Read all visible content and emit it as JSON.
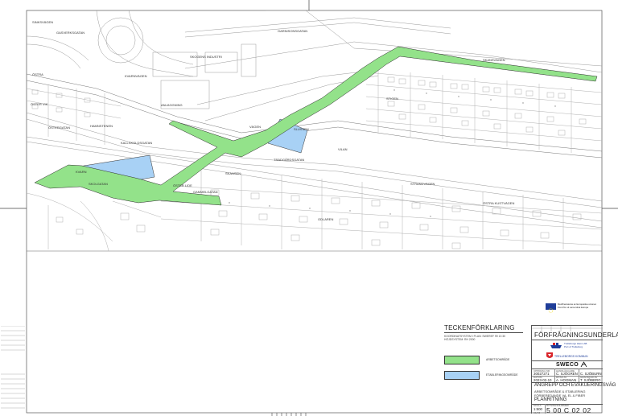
{
  "map": {
    "place_labels": {
      "sinksvagen": "SINKSVÄGEN",
      "gasverksgatan": "GASVERKSGATAN",
      "garnisonsgatan": "GARNISONSGATAN",
      "skansvagen": "SKANSVÄGEN",
      "skogens": "SKOGENS INDUSTRI",
      "kvarnvagen": "KVARNVÄGEN",
      "ostervik": "ÖSTER VIK",
      "ostergatan": "ÖSTERGATAN",
      "ostra": "ÖSTRA",
      "hamnstenen": "HAMNSTENEN",
      "kallskoldsgatan": "KALLSKOLDSGATAN",
      "tradgardsgatan": "TRÄDGÅRDSGATAN",
      "strandvagen": "STRANDVÄGEN",
      "ostra_kustvagen": "ÖSTRA KUSTVÄGEN",
      "skolgatan": "SKOLGATAN",
      "kvarn": "KVARN",
      "skansen": "SKANSEN",
      "gammelgatan": "GAMMELGATAN",
      "oster_lide": "ÖSTER LIDE",
      "vilan": "VILAN",
      "odlaren": "ODLAREN",
      "slussen": "SLUSSEN",
      "anlaggning": "ANLÄGGNING",
      "vagen": "VÄGEN",
      "stigen": "STIGEN"
    }
  },
  "legend": {
    "title": "TECKENFÖRKLARING",
    "subtitle_1": "KOORDINATSYSTEM I PLAN: SWEREF 99 13 30",
    "subtitle_2": "HÖJDSYSTEM: RH 2000",
    "items": [
      {
        "label": "ARBETSOMRÅDE",
        "color": "#93e28a"
      },
      {
        "label": "ETABLERINGSOMRÅDE",
        "color": "#a8d1f5"
      }
    ]
  },
  "titleblock": {
    "eu_logo_text_1": "Medfinansieras av Europeiska unionen",
    "eu_logo_text_2": "Fond för ett samordnat Europa",
    "header": "FÖRFRÅGNINGSUNDERLAG",
    "client_1_text_1": "Trelleborgs Hamn AB",
    "client_1_text_2": "Port of Trelleborg",
    "client_2_text": "TRELLEBORGS KOMMUN",
    "consultant": "SWECO",
    "field_labels": {
      "doc_no": "UPPDRAG NR",
      "designed_by": "HANDLÄGGARE",
      "date": "DATUM",
      "drawn_by": "RITAD AV",
      "approved_by": "GRANSKAD AV",
      "scale": "SKALA",
      "drawing_no": "RITNINGSNUMMER"
    },
    "values": {
      "doc_no": "30027271",
      "designed_by": "C. SJÖGREN",
      "approved": "C. SJÖBURN",
      "date": "2023-02-10",
      "drawn_by": "A. HOGMAN",
      "checked": "T. SJÖBERG",
      "scale": "1:500",
      "scale_sub": "A1/A3"
    },
    "project_title_1": "ANGREPP OCH EVAKUERINGSVÄG",
    "project_title_2": "ARBETSOMRÅDE & ETABLERING",
    "project_title_3": "FÖRBEREDANDE VA, EL & FIBER",
    "drawing_type": "PLANRITNING",
    "drawing_number": "5 00 C 02 02"
  }
}
